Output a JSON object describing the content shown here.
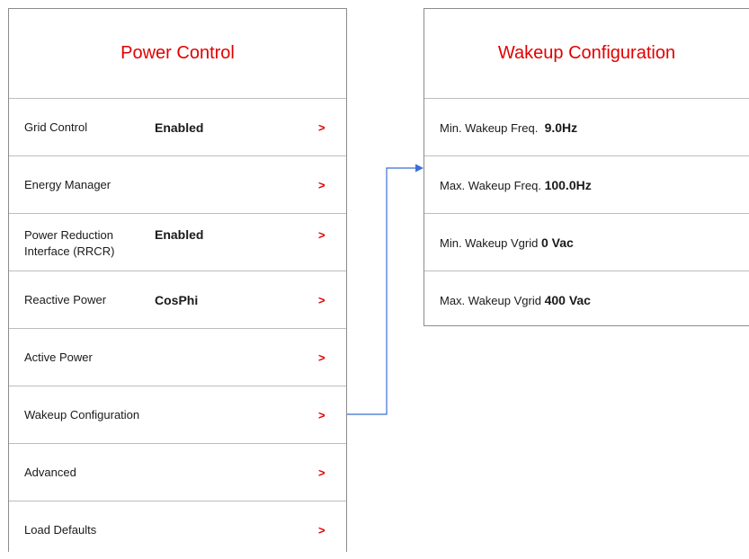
{
  "power_control": {
    "title": "Power Control",
    "items": [
      {
        "label": "Grid Control",
        "value": "Enabled",
        "chevron": ">"
      },
      {
        "label": "Energy Manager",
        "value": "",
        "chevron": ">"
      },
      {
        "label": "Power Reduction Interface (RRCR)",
        "value": "Enabled",
        "chevron": ">"
      },
      {
        "label": "Reactive Power",
        "value": "CosPhi",
        "chevron": ">"
      },
      {
        "label": "Active Power",
        "value": "",
        "chevron": ">"
      },
      {
        "label": "Wakeup Configuration",
        "value": "",
        "chevron": ">"
      },
      {
        "label": "Advanced",
        "value": "",
        "chevron": ">"
      },
      {
        "label": "Load Defaults",
        "value": "",
        "chevron": ">"
      }
    ]
  },
  "wakeup_configuration": {
    "title": "Wakeup Configuration",
    "items": [
      {
        "label": "Min. Wakeup Freq.",
        "value": "9.0Hz"
      },
      {
        "label": "Max. Wakeup Freq.",
        "value": "100.0Hz"
      },
      {
        "label": "Min. Wakeup Vgrid",
        "value": "0 Vac"
      },
      {
        "label": "Max. Wakeup Vgrid",
        "value": "400 Vac"
      }
    ]
  },
  "colors": {
    "title": "#e10000",
    "chevron": "#e10000",
    "connector": "#3b6fd4",
    "border": "#8c8c8c"
  },
  "icons": {
    "chevron": "chevron-right-icon",
    "connector_arrow": "arrow-right-icon"
  }
}
